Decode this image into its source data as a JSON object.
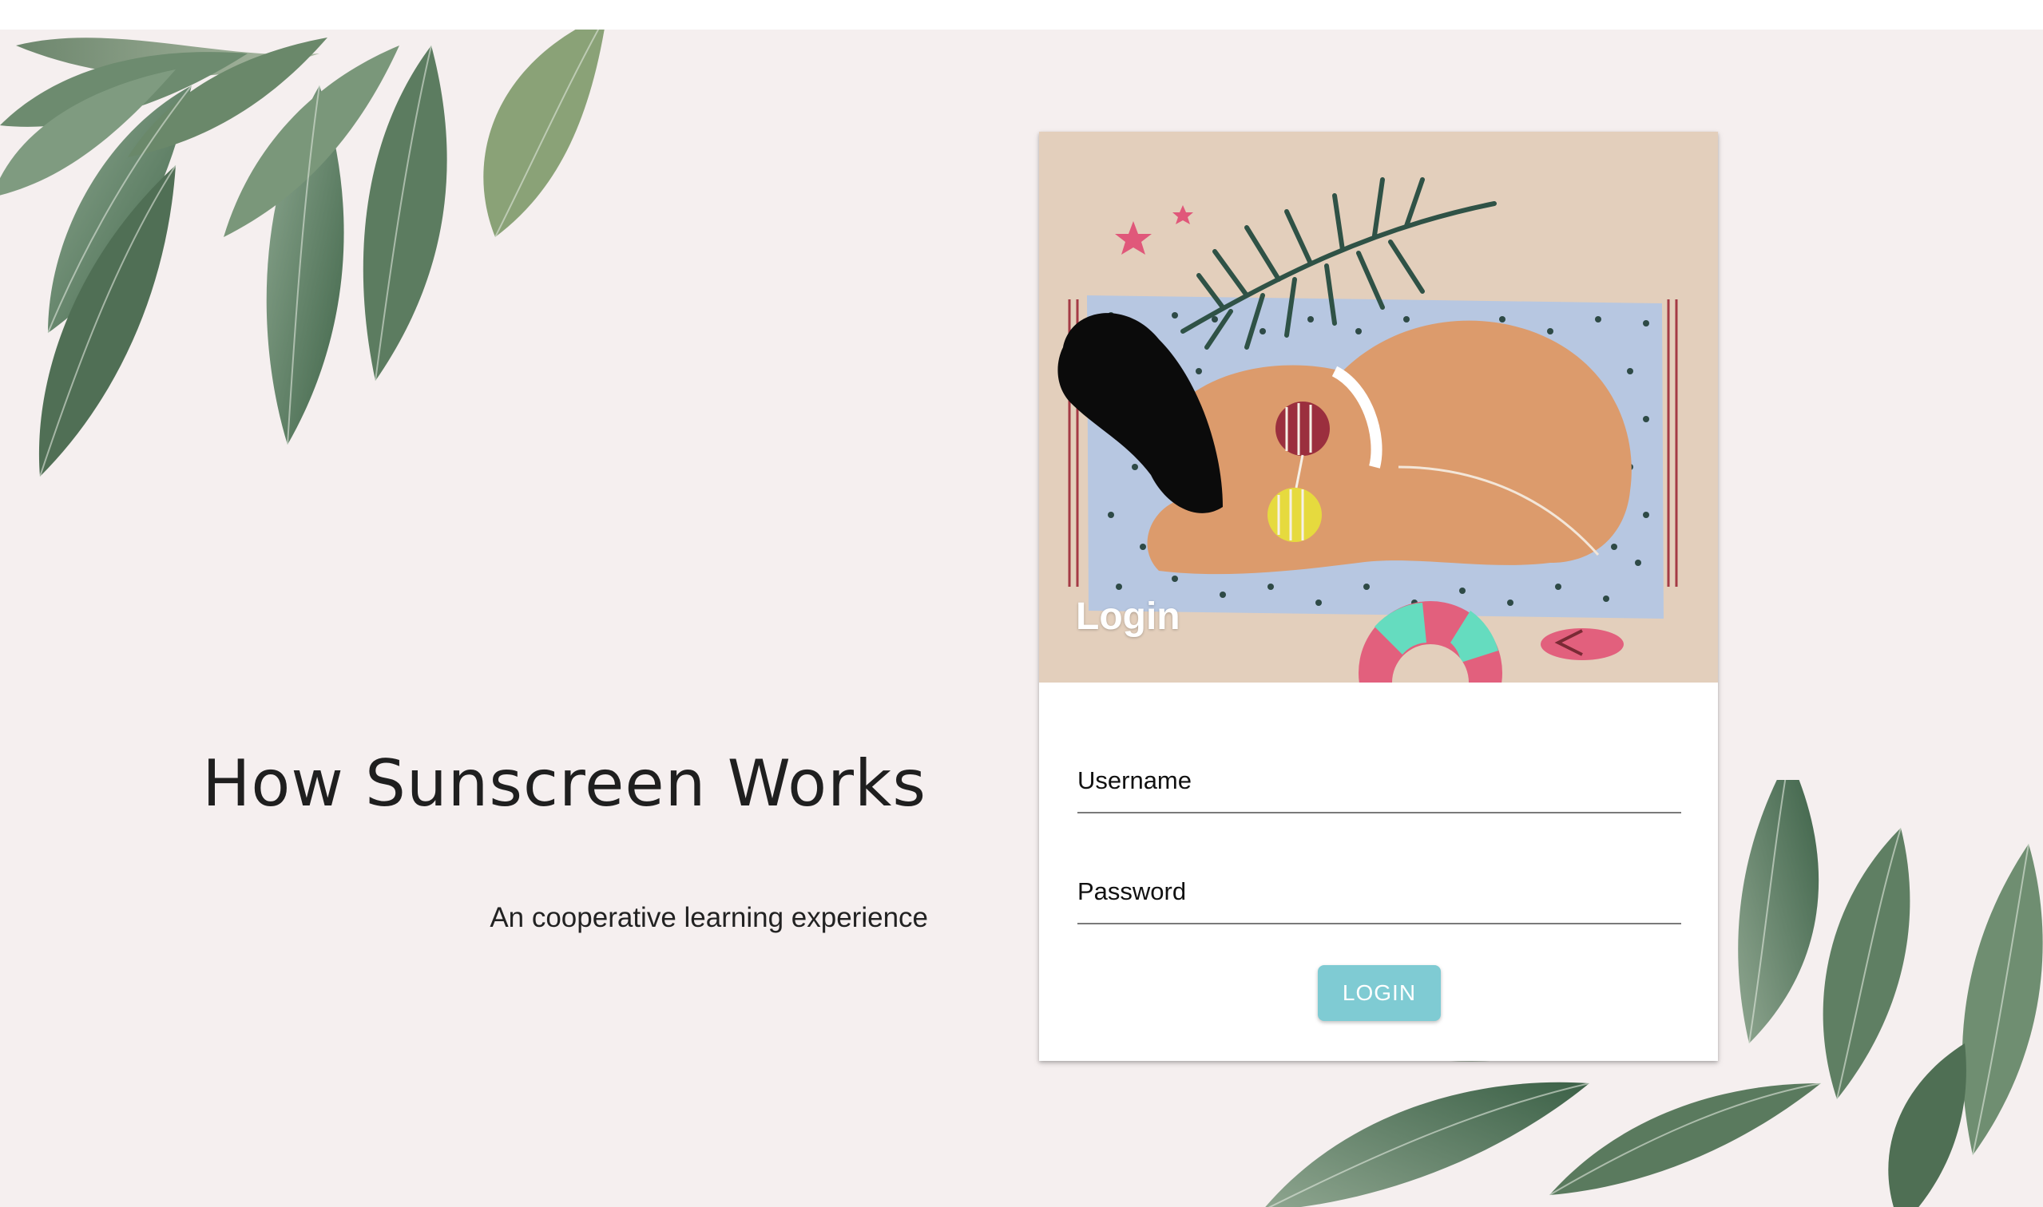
{
  "hero": {
    "title": "How Sunscreen Works",
    "subtitle": "An cooperative learning experience"
  },
  "card": {
    "title": "Login",
    "illustration": "woman-sunbathing-on-beach-towel",
    "username": {
      "label": "Username",
      "value": ""
    },
    "password": {
      "label": "Password",
      "value": ""
    },
    "login_label": "LOGIN"
  },
  "colors": {
    "page_background": "#f5efef",
    "card_media_background": "#e3cfbc",
    "button": "#7fcbd3",
    "leaf": "#5f8064"
  },
  "decorations": [
    "tropical-leaves-top-left",
    "tropical-leaves-bottom-right"
  ]
}
